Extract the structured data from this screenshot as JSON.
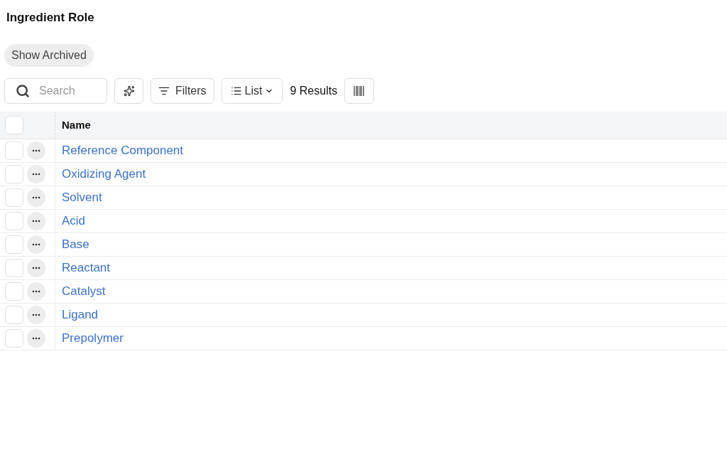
{
  "title": "Ingredient Role",
  "show_archived": {
    "label": "Show Archived"
  },
  "toolbar": {
    "search": {
      "placeholder": "Search"
    },
    "filters": "Filters",
    "view": "List",
    "results": "9 Results"
  },
  "table": {
    "select_all": {
      "checked": false
    },
    "columns": [
      "Name"
    ],
    "rows": [
      {
        "name": "Reference Component",
        "checked": false
      },
      {
        "name": "Oxidizing Agent",
        "checked": false
      },
      {
        "name": "Solvent",
        "checked": false
      },
      {
        "name": "Acid",
        "checked": false
      },
      {
        "name": "Base",
        "checked": false
      },
      {
        "name": "Reactant",
        "checked": false
      },
      {
        "name": "Catalyst",
        "checked": false
      },
      {
        "name": "Ligand",
        "checked": false
      },
      {
        "name": "Prepolymer",
        "checked": false
      }
    ]
  }
}
